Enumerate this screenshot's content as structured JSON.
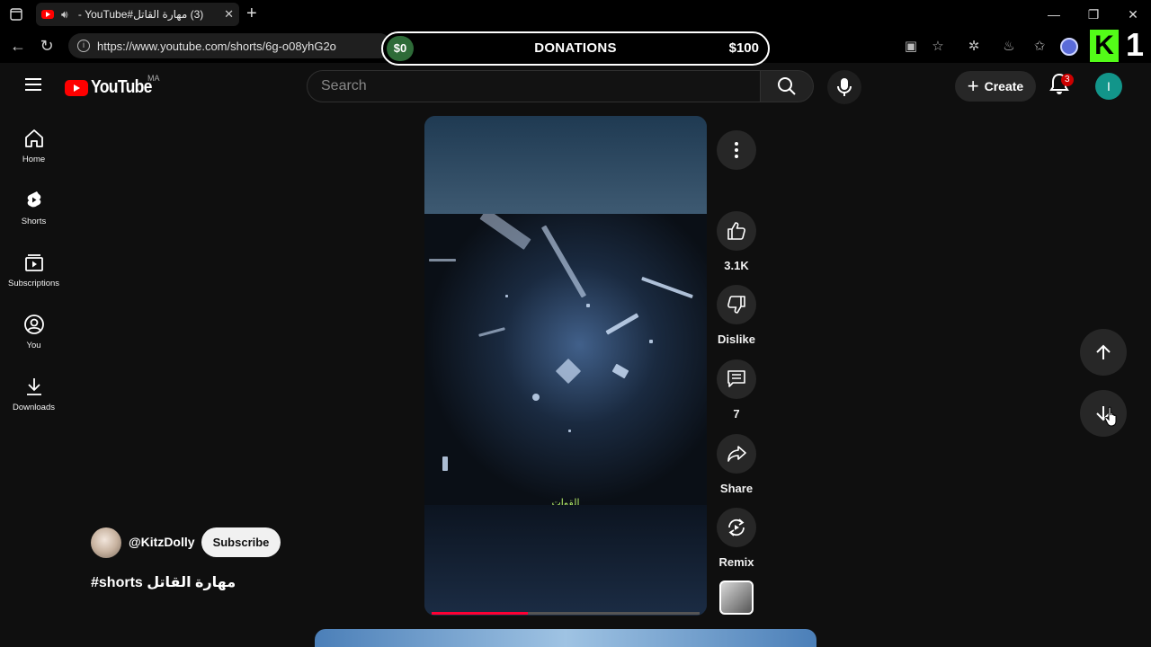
{
  "browser": {
    "tab_title": "(3) مهارة القاتل#YouTube - ⁩",
    "url": "https://www.youtube.com/shorts/6g-o08yhG2o"
  },
  "donation_bar": {
    "left": "$0",
    "title": "DONATIONS",
    "right": "$100"
  },
  "overlay": {
    "kick_letter": "K",
    "number": "1"
  },
  "header": {
    "logo_text": "YouTube",
    "country_code": "MA",
    "search_placeholder": "Search",
    "create_label": "Create",
    "notification_count": "3",
    "avatar_letter": "I"
  },
  "sidebar": {
    "items": [
      {
        "label": "Home"
      },
      {
        "label": "Shorts"
      },
      {
        "label": "Subscriptions"
      },
      {
        "label": "You"
      },
      {
        "label": "Downloads"
      }
    ]
  },
  "short": {
    "caption": "القوات",
    "channel_name": "@KitzDolly",
    "subscribe_label": "Subscribe",
    "title": "#shorts مهارة القاتل",
    "progress": 0.36
  },
  "actions": {
    "like_count": "3.1K",
    "dislike_label": "Dislike",
    "comment_count": "7",
    "share_label": "Share",
    "remix_label": "Remix"
  },
  "colors": {
    "brand": "#ff0000",
    "accent_progress": "#ff0033",
    "kick": "#53fc18",
    "avatar": "#12958a"
  }
}
